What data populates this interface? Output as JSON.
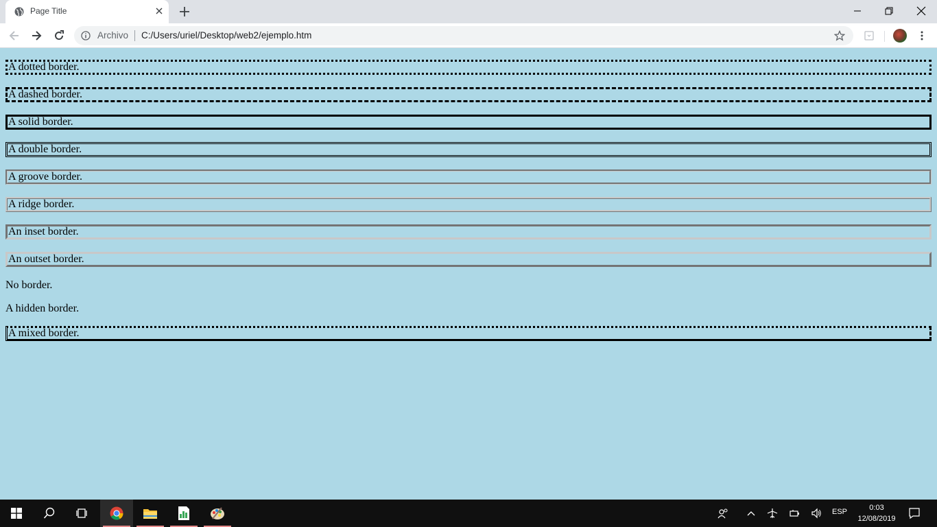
{
  "browser": {
    "tab_title": "Page Title",
    "url_scheme_label": "Archivo",
    "url": "C:/Users/uriel/Desktop/web2/ejemplo.htm"
  },
  "page": {
    "background": "#add8e6",
    "items": [
      {
        "text": "A dotted border.",
        "style": "dotted"
      },
      {
        "text": "A dashed border.",
        "style": "dashed"
      },
      {
        "text": "A solid border.",
        "style": "solid"
      },
      {
        "text": "A double border.",
        "style": "double"
      },
      {
        "text": "A groove border.",
        "style": "groove"
      },
      {
        "text": "A ridge border.",
        "style": "ridge"
      },
      {
        "text": "An inset border.",
        "style": "inset"
      },
      {
        "text": "An outset border.",
        "style": "outset"
      },
      {
        "text": "No border.",
        "style": "none"
      },
      {
        "text": "A hidden border.",
        "style": "hidden"
      },
      {
        "text": "A mixed border.",
        "style": "dotted dashed solid double"
      }
    ]
  },
  "taskbar": {
    "apps": [
      "windows-start-icon",
      "search-icon",
      "task-view-icon",
      "chrome-icon",
      "file-explorer-icon",
      "spreadsheet-app-icon",
      "paint-app-icon"
    ],
    "language": "ESP",
    "time": "0:03",
    "date": "12/08/2019"
  }
}
